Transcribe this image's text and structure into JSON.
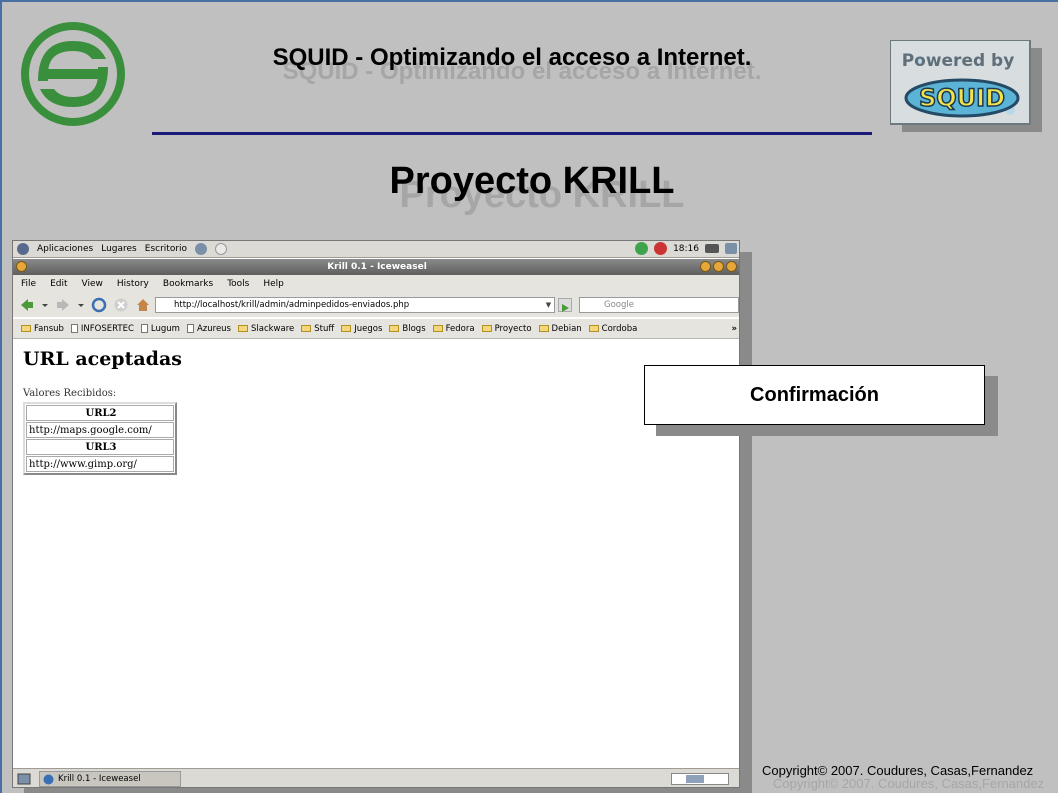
{
  "slide": {
    "title": "SQUID - Optimizando el acceso a Internet.",
    "subtitle": "Proyecto KRILL",
    "confirm_label": "Confirmación",
    "copyright": "Copyright© 2007. Coudures, Casas,Fernandez"
  },
  "powered_logo": {
    "text_top": "Powered by",
    "text_main": "SQUID"
  },
  "gnome_panel": {
    "menus": [
      "Aplicaciones",
      "Lugares",
      "Escritorio"
    ],
    "clock": "18:16"
  },
  "browser": {
    "window_title": "Krill 0.1 - Iceweasel",
    "menu": [
      "File",
      "Edit",
      "View",
      "History",
      "Bookmarks",
      "Tools",
      "Help"
    ],
    "url": "http://localhost/krill/admin/adminpedidos-enviados.php",
    "search_placeholder": "Google",
    "bookmarks": [
      "Fansub",
      "INFOSERTEC",
      "Lugum",
      "Azureus",
      "Slackware",
      "Stuff",
      "Juegos",
      "Blogs",
      "Fedora",
      "Proyecto",
      "Debian",
      "Cordoba"
    ],
    "bookmarks_more": "»"
  },
  "page": {
    "heading": "URL aceptadas",
    "received_label": "Valores Recibidos:",
    "rows": [
      {
        "header": "URL2",
        "value": "http://maps.google.com/"
      },
      {
        "header": "URL3",
        "value": "http://www.gimp.org/"
      }
    ]
  },
  "taskbar": {
    "item": "Krill 0.1 - Iceweasel"
  },
  "colors": {
    "slide_bg": "#c0c0c0",
    "title_rule": "#1a1a7a",
    "logo_green": "#3a8f3c"
  }
}
